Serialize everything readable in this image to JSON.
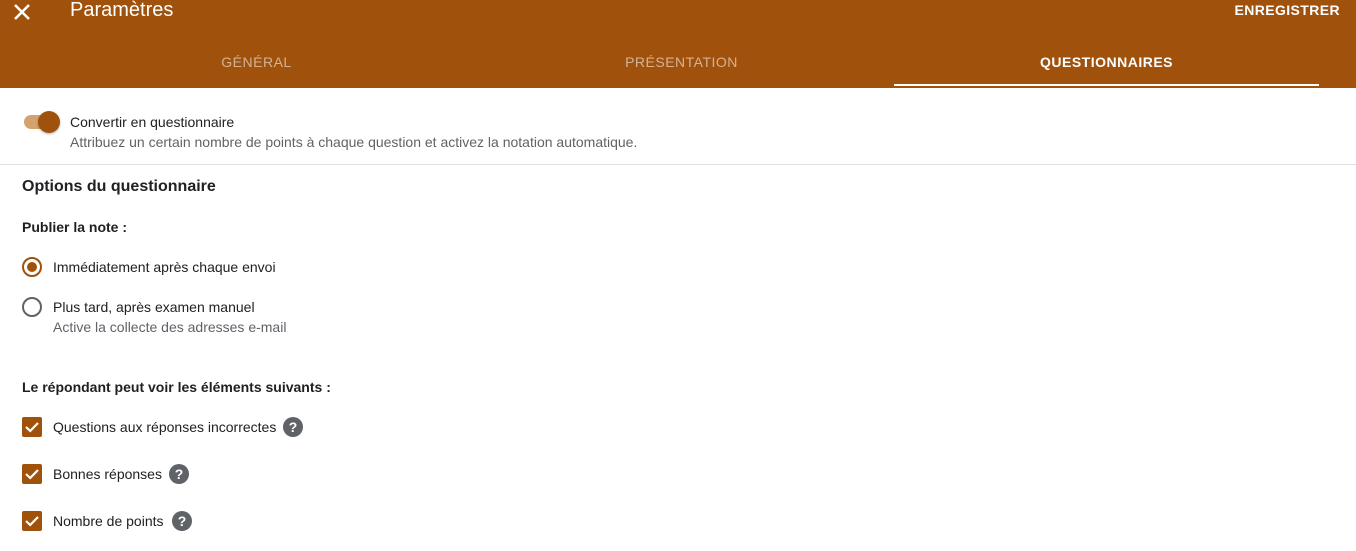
{
  "header": {
    "title": "Paramètres",
    "save_label": "ENREGISTRER",
    "tabs": [
      {
        "label": "GÉNÉRAL",
        "active": false
      },
      {
        "label": "PRÉSENTATION",
        "active": false
      },
      {
        "label": "QUESTIONNAIRES",
        "active": true
      }
    ]
  },
  "quiz_toggle": {
    "label": "Convertir en questionnaire",
    "description": "Attribuez un certain nombre de points à chaque question et activez la notation automatique.",
    "enabled": true
  },
  "options": {
    "section_title": "Options du questionnaire",
    "release_grade": {
      "label": "Publier la note :",
      "choices": [
        {
          "label": "Immédiatement après chaque envoi",
          "selected": true
        },
        {
          "label": "Plus tard, après examen manuel",
          "sub": "Active la collecte des adresses e-mail",
          "selected": false
        }
      ]
    },
    "respondent_sees": {
      "label": "Le répondant peut voir les éléments suivants :",
      "items": [
        {
          "label": "Questions aux réponses incorrectes",
          "checked": true
        },
        {
          "label": "Bonnes réponses",
          "checked": true
        },
        {
          "label": "Nombre de points",
          "checked": true
        }
      ]
    }
  },
  "colors": {
    "accent": "#a0520d",
    "toggle_track": "#d4a26f"
  },
  "icons": {
    "close": "close-icon",
    "help": "help-circle-icon",
    "check": "check-icon"
  }
}
